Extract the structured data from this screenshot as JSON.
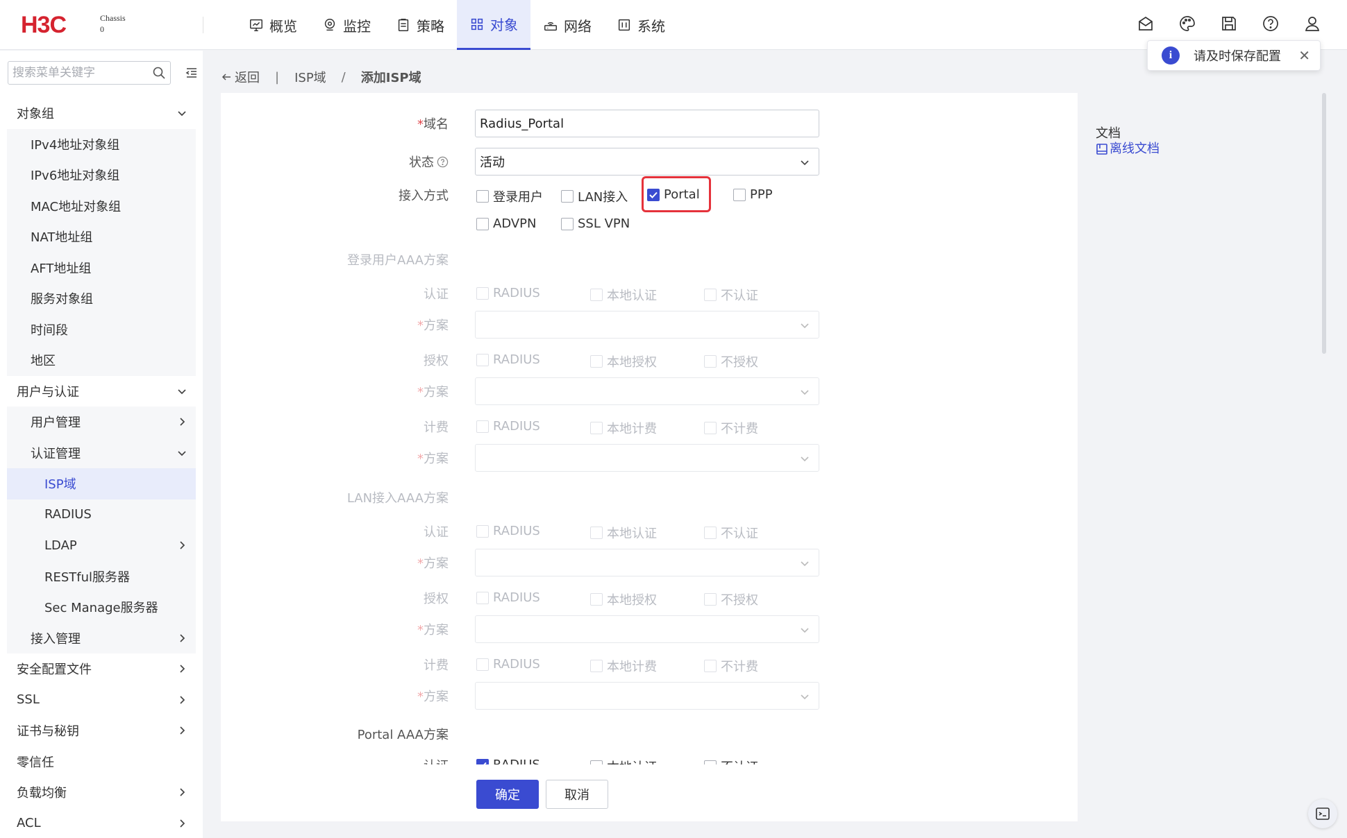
{
  "header": {
    "brand": "H3C",
    "chassis_line1": "Chassis",
    "chassis_line2": "0",
    "nav": [
      {
        "label": "概览",
        "icon": "monitor-icon"
      },
      {
        "label": "监控",
        "icon": "location-icon"
      },
      {
        "label": "策略",
        "icon": "clipboard-icon"
      },
      {
        "label": "对象",
        "icon": "grid-icon"
      },
      {
        "label": "网络",
        "icon": "router-icon"
      },
      {
        "label": "系统",
        "icon": "system-icon"
      }
    ],
    "active_nav": "对象",
    "accent": "#3a4bd1"
  },
  "toast": {
    "message": "请及时保存配置"
  },
  "sidebar": {
    "search_placeholder": "搜索菜单关键字",
    "items": [
      {
        "label": "对象组",
        "level": 1,
        "chevron": "down"
      },
      {
        "label": "IPv4地址对象组",
        "level": 2
      },
      {
        "label": "IPv6地址对象组",
        "level": 2
      },
      {
        "label": "MAC地址对象组",
        "level": 2
      },
      {
        "label": "NAT地址组",
        "level": 2
      },
      {
        "label": "AFT地址组",
        "level": 2
      },
      {
        "label": "服务对象组",
        "level": 2
      },
      {
        "label": "时间段",
        "level": 2
      },
      {
        "label": "地区",
        "level": 2
      },
      {
        "label": "用户与认证",
        "level": 1,
        "chevron": "down"
      },
      {
        "label": "用户管理",
        "level": 2,
        "chevron": "right"
      },
      {
        "label": "认证管理",
        "level": 2,
        "chevron": "down"
      },
      {
        "label": "ISP域",
        "level": 3,
        "selected": true
      },
      {
        "label": "RADIUS",
        "level": 3
      },
      {
        "label": "LDAP",
        "level": 3,
        "chevron": "right"
      },
      {
        "label": "RESTful服务器",
        "level": 3
      },
      {
        "label": "Sec Manage服务器",
        "level": 3
      },
      {
        "label": "接入管理",
        "level": 2,
        "chevron": "right"
      },
      {
        "label": "安全配置文件",
        "level": 1,
        "chevron": "right"
      },
      {
        "label": "SSL",
        "level": 1,
        "chevron": "right"
      },
      {
        "label": "证书与秘钥",
        "level": 1,
        "chevron": "right"
      },
      {
        "label": "零信任",
        "level": 1
      },
      {
        "label": "负载均衡",
        "level": 1,
        "chevron": "right"
      },
      {
        "label": "ACL",
        "level": 1,
        "chevron": "right"
      }
    ]
  },
  "breadcrumb": {
    "back": "返回",
    "parent": "ISP域",
    "current": "添加ISP域"
  },
  "form": {
    "domain_label": "域名",
    "domain_value": "Radius_Portal",
    "status_label": "状态",
    "status_value": "活动",
    "access_label": "接入方式",
    "access_options": [
      {
        "label": "登录用户",
        "checked": false
      },
      {
        "label": "LAN接入",
        "checked": false
      },
      {
        "label": "Portal",
        "checked": true
      },
      {
        "label": "PPP",
        "checked": false
      },
      {
        "label": "ADVPN",
        "checked": false
      },
      {
        "label": "SSL VPN",
        "checked": false
      }
    ],
    "login_section": "登录用户AAA方案",
    "lan_section": "LAN接入AAA方案",
    "portal_section": "Portal AAA方案",
    "auth_label": "认证",
    "authz_label": "授权",
    "acct_label": "计费",
    "scheme_label": "方案",
    "radius": "RADIUS",
    "local_auth": "本地认证",
    "no_auth": "不认证",
    "local_authz": "本地授权",
    "no_authz": "不授权",
    "local_acct": "本地计费",
    "no_acct": "不计费"
  },
  "buttons": {
    "ok": "确定",
    "cancel": "取消"
  },
  "docs": {
    "title": "文档",
    "link": "离线文档"
  }
}
